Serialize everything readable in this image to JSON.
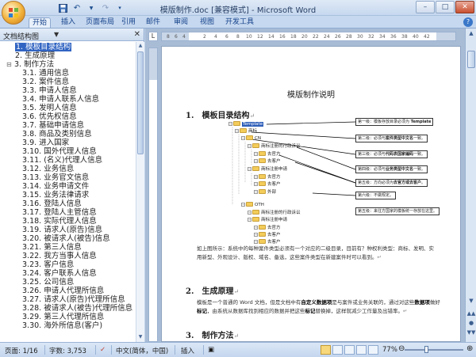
{
  "window": {
    "title": "模版制作.doc [兼容模式] - Microsoft Word"
  },
  "ribbon": {
    "tabs": [
      "开始",
      "插入",
      "页面布局",
      "引用",
      "邮件",
      "审阅",
      "视图",
      "开发工具"
    ],
    "active_tab": 0
  },
  "document_map": {
    "dropdown_label": "文档结构图",
    "items": [
      {
        "label": "1. 模板目录结构",
        "level": 1,
        "selected": true
      },
      {
        "label": "2. 生成原理",
        "level": 1
      },
      {
        "label": "3. 制作方法",
        "level": 1,
        "expanded": true
      },
      {
        "label": "3.1. 通用信息",
        "level": 2
      },
      {
        "label": "3.2. 案件信息",
        "level": 2
      },
      {
        "label": "3.3. 申请人信息",
        "level": 2
      },
      {
        "label": "3.4. 申请人联系人信息",
        "level": 2
      },
      {
        "label": "3.5. 发明人信息",
        "level": 2
      },
      {
        "label": "3.6. 优先权信息",
        "level": 2
      },
      {
        "label": "3.7. 基础申请信息",
        "level": 2
      },
      {
        "label": "3.8. 商品及类别信息",
        "level": 2
      },
      {
        "label": "3.9. 进入国家",
        "level": 2
      },
      {
        "label": "3.10. 国外代理人信息",
        "level": 2
      },
      {
        "label": "3.11. (名义)代理人信息",
        "level": 2
      },
      {
        "label": "3.12. 业务信息",
        "level": 2
      },
      {
        "label": "3.13. 业务官文信息",
        "level": 2
      },
      {
        "label": "3.14. 业务申请文件",
        "level": 2
      },
      {
        "label": "3.15. 业务法律请求",
        "level": 2
      },
      {
        "label": "3.16. 登陆人信息",
        "level": 2
      },
      {
        "label": "3.17. 登陆人主管信息",
        "level": 2
      },
      {
        "label": "3.18. 实际代理人信息",
        "level": 2
      },
      {
        "label": "3.19. 请求人(原告)信息",
        "level": 2
      },
      {
        "label": "3.20. 被请求人(被告)信息",
        "level": 2
      },
      {
        "label": "3.21. 第三人信息",
        "level": 2
      },
      {
        "label": "3.22. 我方当事人信息",
        "level": 2
      },
      {
        "label": "3.23. 客户信息",
        "level": 2
      },
      {
        "label": "3.24. 客户联系人信息",
        "level": 2
      },
      {
        "label": "3.25. 公司信息",
        "level": 2
      },
      {
        "label": "3.26. 申请人代理所信息",
        "level": 2
      },
      {
        "label": "3.27. 请求人(原告)代理所信息",
        "level": 2
      },
      {
        "label": "3.28. 被请求人(被告)代理所信息",
        "level": 2
      },
      {
        "label": "3.29. 第三人代理所信息",
        "level": 2
      },
      {
        "label": "3.30. 海外所信息(客户)",
        "level": 2
      }
    ]
  },
  "document": {
    "title": "模版制作说明",
    "sections": [
      {
        "num": "1.",
        "heading": "模板目录结构"
      },
      {
        "num": "2.",
        "heading": "生成原理"
      },
      {
        "num": "3.",
        "heading": "制作方法"
      }
    ],
    "tree": [
      {
        "label": "Template",
        "selected": true
      },
      {
        "label": "商标"
      },
      {
        "label": "CN"
      },
      {
        "label": "商标注册的行政诉讼"
      },
      {
        "label": "去官方"
      },
      {
        "label": "去客户"
      },
      {
        "label": "商标注册申请"
      },
      {
        "label": "去官方"
      },
      {
        "label": "去客户"
      },
      {
        "label": "外部"
      },
      {
        "label": "OTH"
      },
      {
        "label": "商标注册的行政诉讼"
      },
      {
        "label": "商标注册申请"
      },
      {
        "label": "去官方"
      },
      {
        "label": "去客户"
      },
      {
        "label": "去客户"
      }
    ],
    "notes": [
      {
        "pre": "第一级：模板存放目录必须为 ",
        "bold": "Template",
        "post": ""
      },
      {
        "pre": "第二级：必须与",
        "bold": "案件类型中文名",
        "post": "一致。"
      },
      {
        "pre": "第三级：必须与",
        "bold": "代码表国家编码",
        "post": "一致。"
      },
      {
        "pre": "第四级：必须与",
        "bold": "业务类型中文名",
        "post": "一致。"
      },
      {
        "pre": "第五级：方向必须为",
        "bold": "去官方或去客户",
        "post": "。"
      },
      {
        "pre": "第六级：不做规定。",
        "bold": "",
        "post": ""
      },
      {
        "pre": "第五级：来往方国家的模板统一存放在这里。",
        "bold": "",
        "post": ""
      }
    ],
    "para1_a": "如上图所示：系统中的每种案件类型必须有一个对应的二级目录，目前有？种权利类型：商标、发明、实用新型、外观设计、版权、域名、备选，这些案件类型在新建案件时可以看到。",
    "para2_a": "模板是一个普通的 Word 文档，但是文档中有",
    "para2_b": "自定义数据项",
    "para2_c": "是与案件或业务关联的，通过对这些",
    "para2_d": "数据项",
    "para2_e": "做好",
    "para2_f": "标记",
    "para2_g": "，由系统从数据库找到相应的数据并把这些",
    "para2_h": "标记",
    "para2_i": "替换掉，这样就减少工作量及出错率。"
  },
  "statusbar": {
    "page": "页面: 1/16",
    "words": "字数: 3,753",
    "language": "中文(简体，中国)",
    "mode": "插入",
    "zoom": "77%",
    "zoom_percent": 77
  }
}
